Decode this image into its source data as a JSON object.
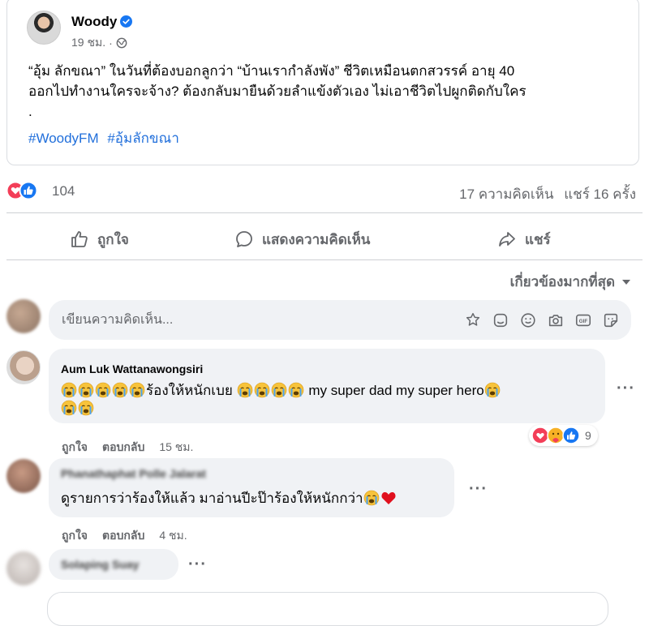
{
  "post": {
    "author": "Woody",
    "time": "19 ชม.",
    "meta_dot": "·",
    "lines": [
      "“อุ้ม ลักขณา” ในวันที่ต้องบอกลูกว่า “บ้านเรากำลังพัง” ชีวิตเหมือนตกสวรรค์ อายุ 40",
      "ออกไปทำงานใครจะจ้าง? ต้องกลับมายืนด้วยลำแข้งตัวเอง ไม่เอาชีวิตไปผูกติดกับใคร",
      "."
    ],
    "hashtags": [
      "#WoodyFM",
      "#อุ้มลักขณา"
    ]
  },
  "stats": {
    "reaction_count": "104",
    "comments": "17 ความคิดเห็น",
    "shares": "แชร์ 16 ครั้ง"
  },
  "actions": {
    "like": "ถูกใจ",
    "comment": "แสดงความคิดเห็น",
    "share": "แชร์"
  },
  "sort_label": "เกี่ยวข้องมากที่สุด",
  "composer": {
    "placeholder": "เขียนความคิดเห็น..."
  },
  "comments": [
    {
      "name": "Aum Luk Wattanawongsiri",
      "text_a": "ร้องให้หนักเบย",
      "text_b": "my super dad my super hero",
      "like": "ถูกใจ",
      "reply": "ตอบกลับ",
      "time": "15 ชม.",
      "reaction_count": "9"
    },
    {
      "name": "Phanathaphat Polle Jalarat",
      "text": "ดูรายการว่าร้องให้แล้ว มาอ่านปีะป๊าร้องให้หนักกว่า",
      "like": "ถูกใจ",
      "reply": "ตอบกลับ",
      "time": "4 ชม."
    },
    {
      "name": "Solaping Suay"
    }
  ],
  "colors": {
    "link": "#216fdb",
    "muted": "#65676b",
    "bubble": "#f0f2f5",
    "like_blue": "#1877f2",
    "love_red": "#f33e58"
  },
  "icons": [
    "verified-icon",
    "globe-icon",
    "love-reaction-icon",
    "like-reaction-icon",
    "like-icon",
    "comment-icon",
    "share-icon",
    "caret-down-icon",
    "avatar-sticker-icon",
    "sticker-icon",
    "emoji-icon",
    "camera-icon",
    "gif-icon",
    "sticker-smile-icon",
    "crying-emoji-icon",
    "heart-icon",
    "care-reaction-icon",
    "more-icon"
  ]
}
